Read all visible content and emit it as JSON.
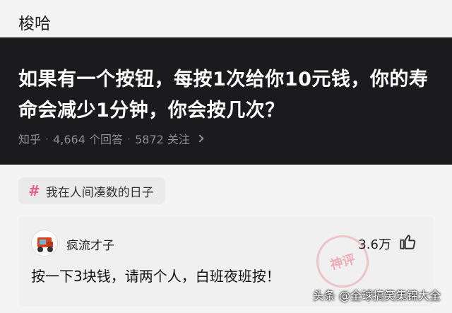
{
  "header": {
    "title": "梭哈"
  },
  "question": {
    "text": "如果有一个按钮，每按1次给你10元钱，你的寿命会减少1分钟，你会按几次？",
    "source": "知乎",
    "answers": "4,664 个回答",
    "followers": "5872 关注"
  },
  "topic": {
    "label": "我在人间凑数的日子",
    "icon": "hash-icon"
  },
  "answer": {
    "author": "疯流才子",
    "likes": "3.6万",
    "content": "按一下3块钱，请两个人，白班夜班按！",
    "stamp": "神评"
  },
  "watermark": "头条 @全球搞笑集锦大全",
  "colors": {
    "accent": "#e8608a",
    "card_dark": "#1b1b1d"
  }
}
